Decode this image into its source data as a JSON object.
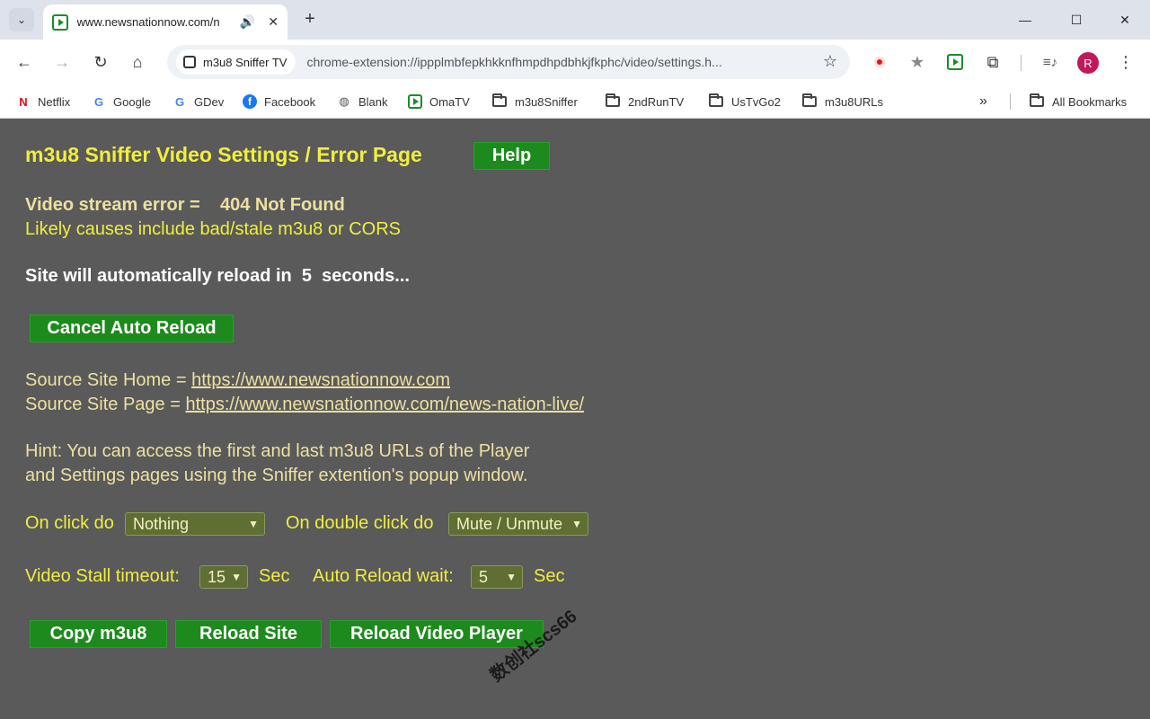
{
  "browser": {
    "tab_title": "www.newsnationnow.com/n",
    "address_chip": "m3u8 Sniffer TV",
    "url": "chrome-extension://ippplmbfepkhkknfhmpdhpdbhkjfkphc/video/settings.h...",
    "avatar_letter": "R",
    "bookmarks": [
      "Netflix",
      "Google",
      "GDev",
      "Facebook",
      "Blank",
      "OmaTV",
      "m3u8Sniffer",
      "2ndRunTV",
      "UsTvGo2",
      "m3u8URLs"
    ],
    "all_bookmarks": "All Bookmarks",
    "more": "»"
  },
  "page": {
    "title": "m3u8 Sniffer Video Settings / Error Page",
    "help_button": "Help",
    "error_label": "Video stream error =",
    "error_value": "404 Not Found",
    "error_causes": "Likely causes include bad/stale m3u8 or CORS",
    "reload_prefix": "Site will automatically reload in",
    "reload_seconds": "5",
    "reload_suffix": "seconds...",
    "cancel_button": "Cancel Auto Reload",
    "source_home_label": "Source Site Home =",
    "source_home_url": "https://www.newsnationnow.com",
    "source_page_label": "Source Site Page =",
    "source_page_url": "https://www.newsnationnow.com/news-nation-live/",
    "hint_line1": "Hint: You can access the first and last m3u8 URLs of the Player",
    "hint_line2": "and Settings pages using the Sniffer extention's popup window.",
    "on_click_label": "On click do",
    "on_click_value": "Nothing",
    "on_double_click_label": "On double click do",
    "on_double_click_value": "Mute / Unmute",
    "stall_label": "Video Stall timeout:",
    "stall_value": "15",
    "stall_unit": "Sec",
    "auto_reload_label": "Auto Reload wait:",
    "auto_reload_value": "5",
    "auto_reload_unit": "Sec",
    "copy_button": "Copy m3u8",
    "reload_site_button": "Reload Site",
    "reload_player_button": "Reload Video Player",
    "watermark": "数创社scs66"
  },
  "colors": {
    "page_bg": "#5a5a5a",
    "title_yellow": "#f1ee3c",
    "text_khaki": "#ede0a0",
    "button_green": "#1d8a1d"
  }
}
